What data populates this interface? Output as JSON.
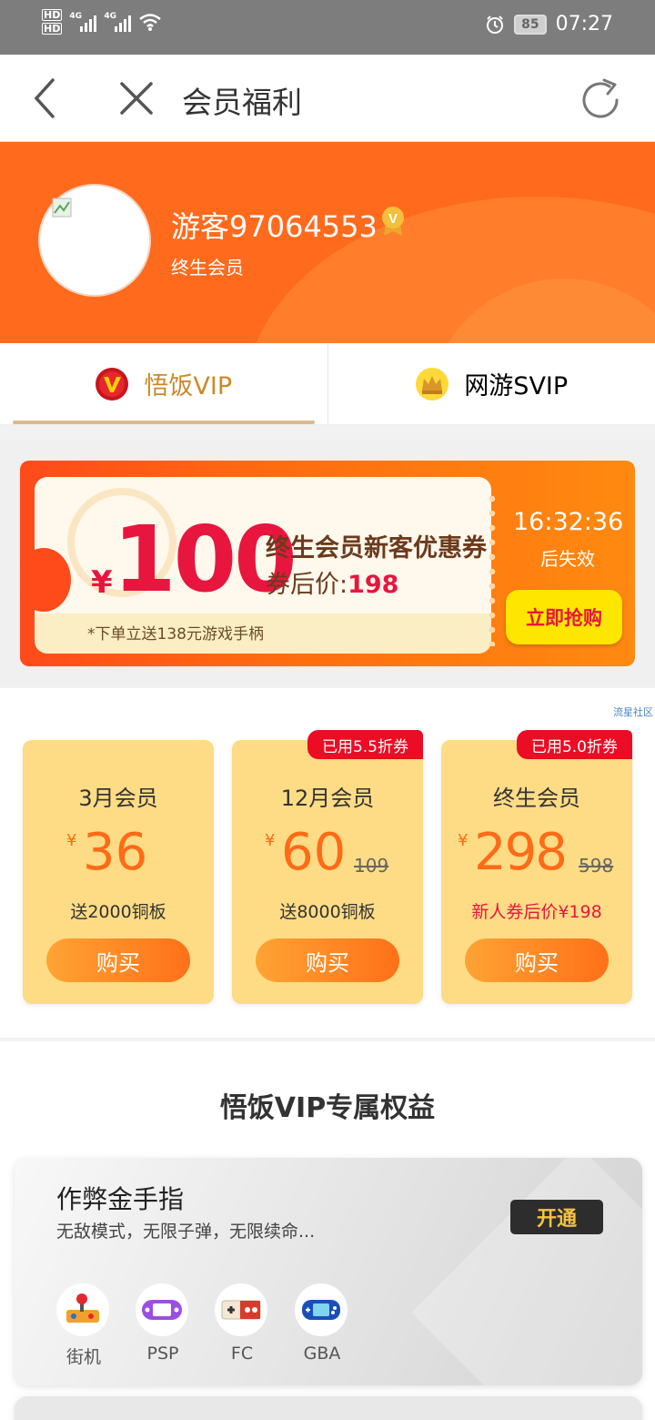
{
  "status_bar": {
    "hd1": "HD",
    "hd2": "HD",
    "net1": "4G",
    "net2": "4G",
    "battery": "85",
    "time": "07:27"
  },
  "nav": {
    "title": "会员福利"
  },
  "profile": {
    "username": "游客97064553",
    "member_type": "终生会员"
  },
  "tabs": [
    {
      "label": "悟饭VIP",
      "active": true
    },
    {
      "label": "网游SVIP",
      "active": false
    }
  ],
  "coupon": {
    "yen": "¥",
    "amount": "100",
    "title": "终生会员新客优惠券",
    "price_label": "券后价:",
    "price_value": "198",
    "note": "*下单立送138元游戏手柄",
    "countdown": "16:32:36",
    "countdown_suffix": "后失效",
    "grab_label": "立即抢购"
  },
  "watermark": "流星社区",
  "plans": [
    {
      "badge": "",
      "name": "3月会员",
      "yen": "¥",
      "price": "36",
      "old_price": "",
      "desc": "送2000铜板",
      "buy_label": "购买"
    },
    {
      "badge": "已用5.5折券",
      "name": "12月会员",
      "yen": "¥",
      "price": "60",
      "old_price": "109",
      "desc": "送8000铜板",
      "buy_label": "购买"
    },
    {
      "badge": "已用5.0折券",
      "name": "终生会员",
      "yen": "¥",
      "price": "298",
      "old_price": "598",
      "desc": "新人券后价¥198",
      "buy_label": "购买"
    }
  ],
  "benefits": {
    "title": "悟饭VIP专属权益",
    "card": {
      "title": "作弊金手指",
      "desc": "无敌模式，无限子弹，无限续命...",
      "open_label": "开通",
      "platforms": [
        {
          "label": "街机",
          "icon": "arcade-joystick-icon"
        },
        {
          "label": "PSP",
          "icon": "psp-console-icon"
        },
        {
          "label": "FC",
          "icon": "fc-controller-icon"
        },
        {
          "label": "GBA",
          "icon": "gba-console-icon"
        }
      ]
    }
  },
  "colors": {
    "orange": "#ff6a1c",
    "gold_text": "#c98a2a",
    "price_red": "#e8163e",
    "plan_bg": "#fddc85"
  }
}
